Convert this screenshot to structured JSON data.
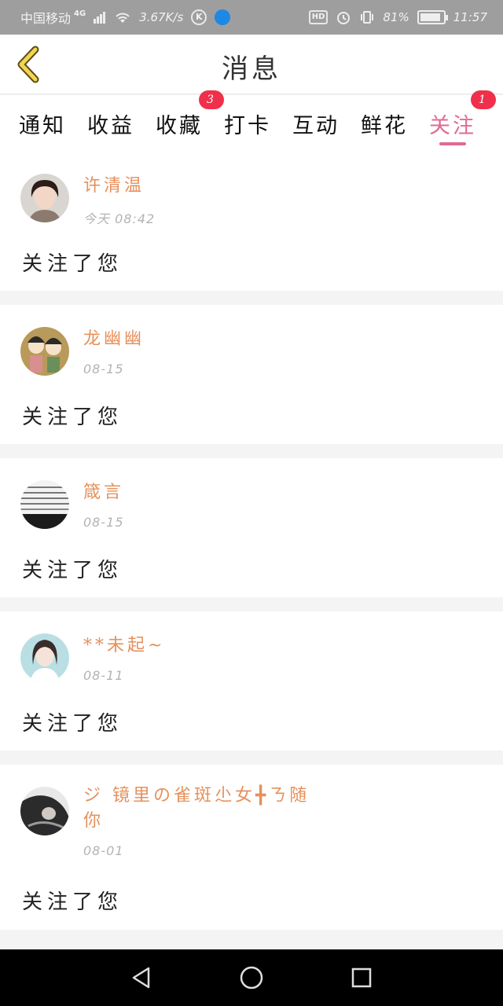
{
  "status_bar": {
    "carrier": "中国移动",
    "network": "4G",
    "speed": "3.67K/s",
    "k_badge": "K",
    "hd": "HD",
    "battery_pct": "81%",
    "time": "11:57"
  },
  "header": {
    "title": "消息"
  },
  "tabs": [
    {
      "label": "通知",
      "badge": ""
    },
    {
      "label": "收益",
      "badge": ""
    },
    {
      "label": "收藏",
      "badge": "3"
    },
    {
      "label": "打卡",
      "badge": ""
    },
    {
      "label": "互动",
      "badge": ""
    },
    {
      "label": "鲜花",
      "badge": ""
    },
    {
      "label": "关注",
      "badge": "1",
      "active": true
    }
  ],
  "items": [
    {
      "name": "许清温",
      "time": "今天 08:42",
      "message": "关注了您"
    },
    {
      "name": "龙幽幽",
      "time": "08-15",
      "message": "关注了您"
    },
    {
      "name": "箴言",
      "time": "08-15",
      "message": "关注了您"
    },
    {
      "name": "**未起~",
      "time": "08-11",
      "message": "关注了您"
    },
    {
      "name": "ジ 镜里の雀斑尐女╋ㄋ随你",
      "time": "08-01",
      "message": "关注了您"
    }
  ],
  "colors": {
    "accent": "#e06b92",
    "name": "#e6905b",
    "badge": "#f0304b"
  }
}
